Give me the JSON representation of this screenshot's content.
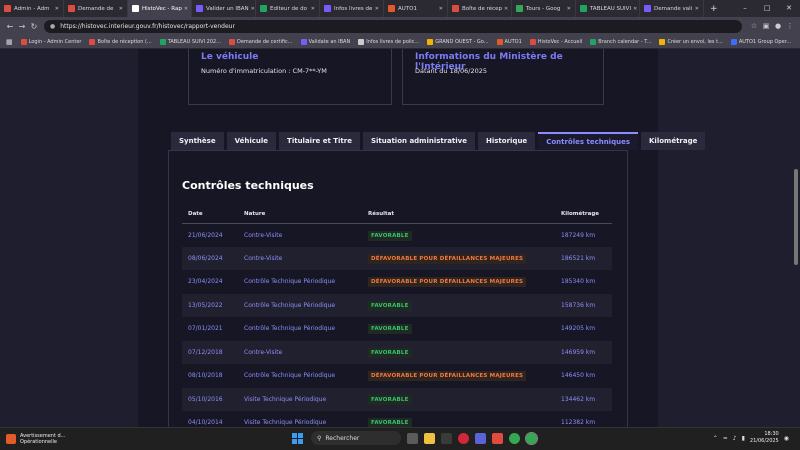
{
  "browser": {
    "tabs": [
      {
        "label": "Admin - Adm",
        "color": "#e04a3f",
        "active": false
      },
      {
        "label": "Demande de",
        "color": "#e04a3f",
        "active": false
      },
      {
        "label": "HistoVec - Rap",
        "color": "#ffffff",
        "active": true
      },
      {
        "label": "Valider un IBAN",
        "color": "#7a5af8",
        "active": false
      },
      {
        "label": "Editeur de do",
        "color": "#1fa463",
        "active": false
      },
      {
        "label": "Infos livres de",
        "color": "#7a5af8",
        "active": false
      },
      {
        "label": "AUTO1",
        "color": "#e2592a",
        "active": false
      },
      {
        "label": "Boîte de récep",
        "color": "#e04a3f",
        "active": false
      },
      {
        "label": "Tours - Goog",
        "color": "#34a853",
        "active": false
      },
      {
        "label": "TABLEAU SUIVI",
        "color": "#1fa463",
        "active": false
      },
      {
        "label": "Demande vali",
        "color": "#7a5af8",
        "active": false
      }
    ],
    "new_tab_label": "+",
    "url": "https://histovec.interieur.gouv.fr/histovec/rapport-vendeur",
    "bookmarks": [
      {
        "label": "Login - Admin Center",
        "color": "#e04a3f"
      },
      {
        "label": "Boîte de réception (...",
        "color": "#e04a3f"
      },
      {
        "label": "TABLEAU SUIVI 202...",
        "color": "#1fa463"
      },
      {
        "label": "Demande de certific...",
        "color": "#e04a3f"
      },
      {
        "label": "Validate an IBAN",
        "color": "#7a5af8"
      },
      {
        "label": "Infos livres de polic...",
        "color": "#cccccc"
      },
      {
        "label": "GRAND OUEST - Go...",
        "color": "#f2b400"
      },
      {
        "label": "AUTO1",
        "color": "#e2592a"
      },
      {
        "label": "HistoVec - Accueil",
        "color": "#e04a3f"
      },
      {
        "label": "Branch calendar - T...",
        "color": "#1fa463"
      },
      {
        "label": "Créer un envoi, les t...",
        "color": "#f2b400"
      },
      {
        "label": "AUTO1 Group Oper...",
        "color": "#3b6ef5"
      }
    ]
  },
  "cards": {
    "vehicle_title": "Le véhicule",
    "vehicle_plate": "Numéro d'immatriculation : CM-7**-YM",
    "ministry_title": "Informations du Ministère de l'Intérieur",
    "ministry_date": "Datant du 18/06/2025"
  },
  "page_tabs": [
    {
      "label": "Synthèse",
      "active": false
    },
    {
      "label": "Véhicule",
      "active": false
    },
    {
      "label": "Titulaire et Titre",
      "active": false
    },
    {
      "label": "Situation administrative",
      "active": false
    },
    {
      "label": "Historique",
      "active": false
    },
    {
      "label": "Contrôles techniques",
      "active": true
    },
    {
      "label": "Kilométrage",
      "active": false
    }
  ],
  "section_title": "Contrôles techniques",
  "table": {
    "headers": [
      "Date",
      "Nature",
      "Résultat",
      "Kilométrage"
    ],
    "rows": [
      {
        "date": "21/06/2024",
        "nature": "Contre-Visite",
        "result": "FAVORABLE",
        "status": "ok",
        "km": "187249 km"
      },
      {
        "date": "08/06/2024",
        "nature": "Contre-Visite",
        "result": "DÉFAVORABLE POUR DÉFAILLANCES MAJEURES",
        "status": "ko",
        "km": "186521 km"
      },
      {
        "date": "23/04/2024",
        "nature": "Contrôle Technique Périodique",
        "result": "DÉFAVORABLE POUR DÉFAILLANCES MAJEURES",
        "status": "ko",
        "km": "185340 km"
      },
      {
        "date": "13/05/2022",
        "nature": "Contrôle Technique Périodique",
        "result": "FAVORABLE",
        "status": "ok",
        "km": "158736 km"
      },
      {
        "date": "07/01/2021",
        "nature": "Contrôle Technique Périodique",
        "result": "FAVORABLE",
        "status": "ok",
        "km": "149205 km"
      },
      {
        "date": "07/12/2018",
        "nature": "Contre-Visite",
        "result": "FAVORABLE",
        "status": "ok",
        "km": "146959 km"
      },
      {
        "date": "08/10/2018",
        "nature": "Contrôle Technique Périodique",
        "result": "DÉFAVORABLE POUR DÉFAILLANCES MAJEURES",
        "status": "ko",
        "km": "146450 km"
      },
      {
        "date": "05/10/2016",
        "nature": "Visite Technique Périodique",
        "result": "FAVORABLE",
        "status": "ok",
        "km": "134462 km"
      },
      {
        "date": "04/10/2014",
        "nature": "Visite Technique Périodique",
        "result": "FAVORABLE",
        "status": "ok",
        "km": "112382 km"
      }
    ]
  },
  "taskbar": {
    "notification_title": "Avertissement d...",
    "notification_sub": "Opérationnelle",
    "search_placeholder": "Rechercher",
    "time": "18:30",
    "date": "21/06/2025"
  },
  "colors": {
    "accent": "#8a8cff",
    "favorable": "#37c46a",
    "defavorable": "#f5793b"
  }
}
